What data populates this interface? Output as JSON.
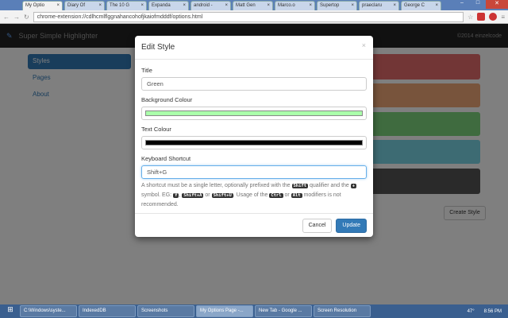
{
  "browser": {
    "tabs": [
      {
        "label": "My Optio",
        "active": true
      },
      {
        "label": "Diary Of"
      },
      {
        "label": "The 10 G"
      },
      {
        "label": "Expanda"
      },
      {
        "label": "android -"
      },
      {
        "label": "Matt Gen"
      },
      {
        "label": "Marco.o"
      },
      {
        "label": "Supertop"
      },
      {
        "label": "praeclaru"
      },
      {
        "label": "George C"
      }
    ],
    "tab_close": "×",
    "url": "chrome-extension://cdlhcmlflggnahancohofjkaiofmdddf/options.html"
  },
  "app": {
    "title": "Super Simple Highlighter",
    "copyright": "©2014 einzelcode"
  },
  "sidebar": {
    "items": [
      {
        "label": "Styles"
      },
      {
        "label": "Pages"
      },
      {
        "label": "About"
      }
    ]
  },
  "styles": {
    "colors": [
      "#e46c6c",
      "#f0a878",
      "#7ed67e",
      "#7ad6e6",
      "#555555"
    ],
    "create_label": "Create Style"
  },
  "modal": {
    "title": "Edit Style",
    "close": "×",
    "title_label": "Title",
    "title_value": "Green",
    "bg_label": "Background Colour",
    "bg_color": "#aaffaa",
    "text_label": "Text Colour",
    "text_color": "#000000",
    "shortcut_label": "Keyboard Shortcut",
    "shortcut_value": "Shift+G",
    "help": {
      "p1": "A shortcut must be a single letter, optionally prefixed with the ",
      "k1": "Shift",
      "p2": " qualifier and the ",
      "k2": "+",
      "p3": " symbol. EG: ",
      "k3": "Y",
      "p4": ", ",
      "k4": "Shift+A",
      "p5": " or ",
      "k5": "Shift+U",
      "p6": ". Usage of the ",
      "k6": "Ctrl",
      "p7": " or ",
      "k7": "Alt",
      "p8": " modifiers is not recommended."
    },
    "cancel": "Cancel",
    "update": "Update"
  },
  "taskbar": {
    "items": [
      {
        "label": "C:\\Windows\\syste..."
      },
      {
        "label": "IndexedDB"
      },
      {
        "label": "Screenshots"
      },
      {
        "label": "My Options Page -...",
        "active": true
      },
      {
        "label": "New Tab - Google ..."
      },
      {
        "label": "Screen Resolution"
      }
    ],
    "time": "8:56 PM",
    "temp": "47°"
  }
}
